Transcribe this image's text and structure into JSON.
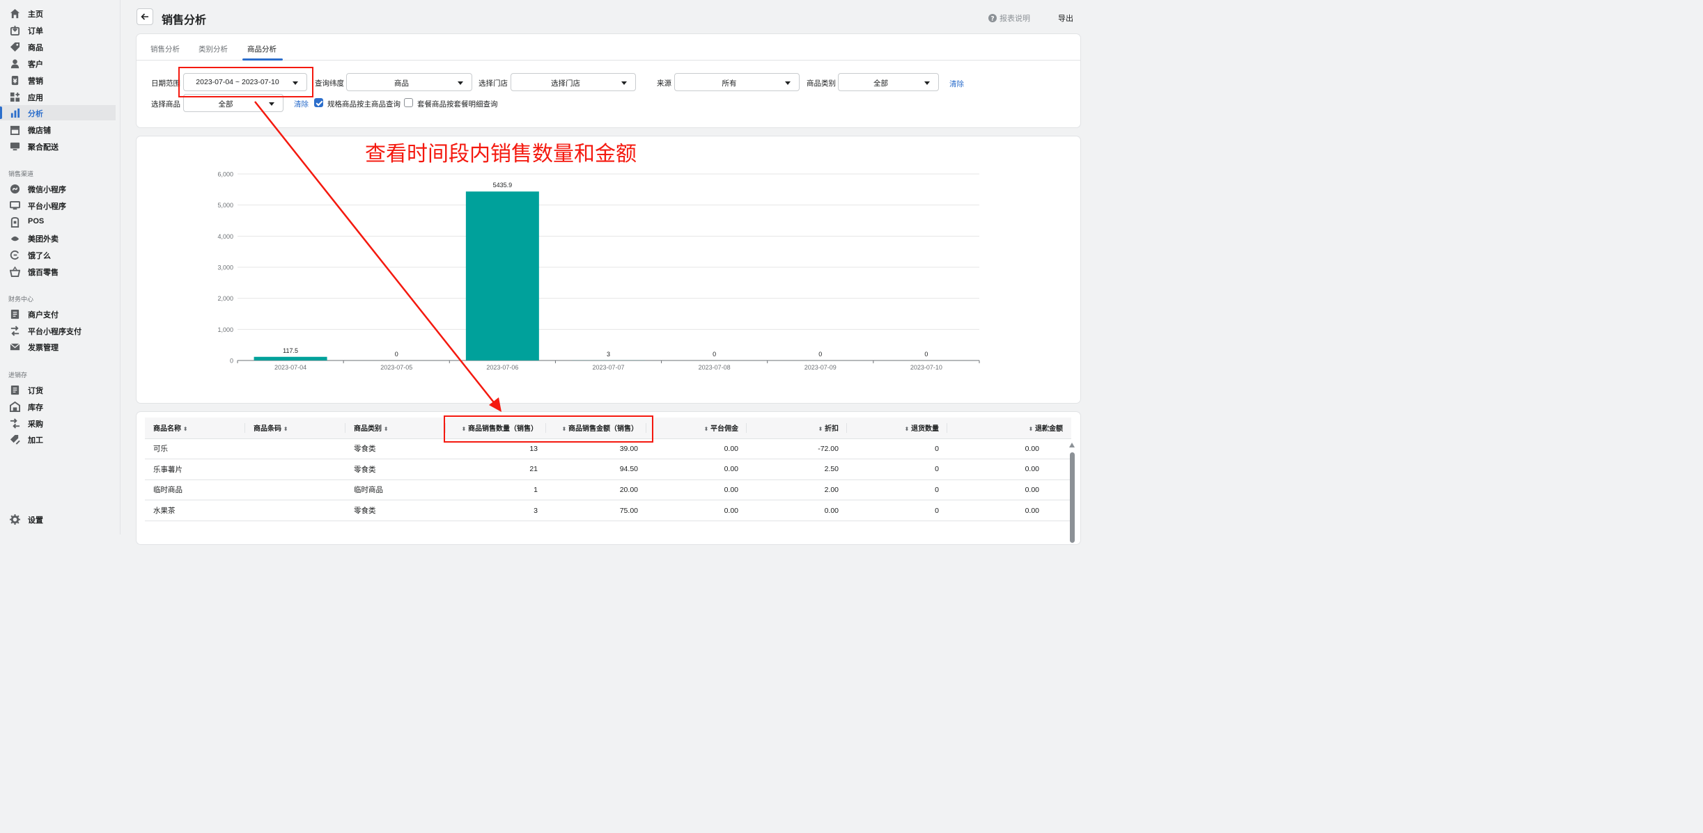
{
  "sidebar": {
    "items": [
      {
        "label": "主页",
        "icon": "home-icon"
      },
      {
        "label": "订单",
        "icon": "order-icon"
      },
      {
        "label": "商品",
        "icon": "tag-icon"
      },
      {
        "label": "客户",
        "icon": "person-icon"
      },
      {
        "label": "营销",
        "icon": "marketing-icon"
      },
      {
        "label": "应用",
        "icon": "apps-icon"
      },
      {
        "label": "分析",
        "icon": "analytics-icon",
        "active": true
      },
      {
        "label": "微店铺",
        "icon": "store-icon"
      },
      {
        "label": "聚合配送",
        "icon": "monitor-icon"
      }
    ],
    "sales_channel_title": "销售渠道",
    "sales_channels": [
      {
        "label": "微信小程序",
        "icon": "miniprogram-icon"
      },
      {
        "label": "平台小程序",
        "icon": "monitor-icon"
      },
      {
        "label": "POS",
        "icon": "pos-icon"
      },
      {
        "label": "美团外卖",
        "icon": "meituan-icon"
      },
      {
        "label": "饿了么",
        "icon": "eleme-icon"
      },
      {
        "label": "饿百零售",
        "icon": "basket-icon"
      }
    ],
    "finance_title": "财务中心",
    "finance": [
      {
        "label": "商户支付",
        "icon": "document-icon"
      },
      {
        "label": "平台小程序支付",
        "icon": "transfer-icon"
      },
      {
        "label": "发票管理",
        "icon": "invoice-icon"
      }
    ],
    "inventory_title": "进销存",
    "inventory": [
      {
        "label": "订货",
        "icon": "document-icon"
      },
      {
        "label": "库存",
        "icon": "warehouse-icon"
      },
      {
        "label": "采购",
        "icon": "purchase-icon"
      },
      {
        "label": "加工",
        "icon": "tag-edit-icon"
      }
    ],
    "settings_label": "设置"
  },
  "header": {
    "title": "销售分析",
    "help_label": "报表说明",
    "export_label": "导出"
  },
  "tabs": [
    "销售分析",
    "类别分析",
    "商品分析"
  ],
  "filters": {
    "date_label": "日期范围",
    "date_value": "2023-07-04 ~ 2023-07-10",
    "dimension_label": "查询纬度",
    "dimension_value": "商品",
    "store_label": "选择门店",
    "store_value": "选择门店",
    "source_label": "来源",
    "source_value": "所有",
    "category_label": "商品类别",
    "category_value": "全部",
    "clear_label": "清除",
    "product_label": "选择商品",
    "product_value": "全部",
    "clear2_label": "清除",
    "check1_label": "规格商品按主商品查询",
    "check2_label": "套餐商品按套餐明细查询"
  },
  "annotation": {
    "text": "查看时间段内销售数量和金额"
  },
  "chart_data": {
    "type": "bar",
    "categories": [
      "2023-07-04",
      "2023-07-05",
      "2023-07-06",
      "2023-07-07",
      "2023-07-08",
      "2023-07-09",
      "2023-07-10"
    ],
    "values": [
      117.5,
      0,
      5435.9,
      3,
      0,
      0,
      0
    ],
    "value_labels": [
      "117.5",
      "0",
      "5435.9",
      "3",
      "0",
      "0",
      "0"
    ],
    "ylim": [
      0,
      6000
    ],
    "yticks": [
      "0",
      "1,000",
      "2,000",
      "3,000",
      "4,000",
      "5,000",
      "6,000"
    ],
    "grid": true,
    "color": "#00a19b"
  },
  "table": {
    "columns": [
      "商品名称",
      "商品条码",
      "商品类别",
      "商品销售数量（销售）",
      "商品销售金额（销售）",
      "平台佣金",
      "折扣",
      "退货数量",
      "退款金额"
    ],
    "rows": [
      [
        "可乐",
        "",
        "零食类",
        "13",
        "39.00",
        "0.00",
        "-72.00",
        "0",
        "0.00"
      ],
      [
        "乐事薯片",
        "",
        "零食类",
        "21",
        "94.50",
        "0.00",
        "2.50",
        "0",
        "0.00"
      ],
      [
        "临时商品",
        "",
        "临时商品",
        "1",
        "20.00",
        "0.00",
        "2.00",
        "0",
        "0.00"
      ],
      [
        "水果茶",
        "",
        "零食类",
        "3",
        "75.00",
        "0.00",
        "0.00",
        "0",
        "0.00"
      ]
    ]
  }
}
